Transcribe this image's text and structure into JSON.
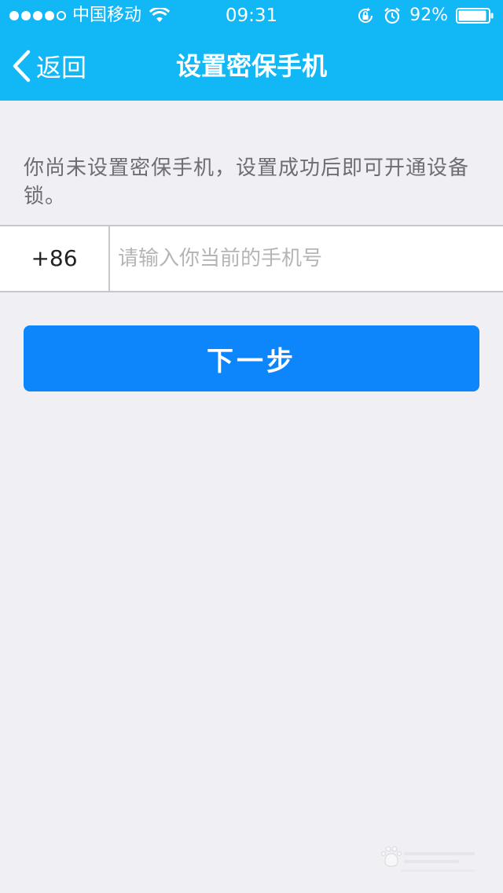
{
  "status_bar": {
    "carrier": "中国移动",
    "time": "09:31",
    "battery": "92%"
  },
  "nav": {
    "back_label": "返回",
    "title": "设置密保手机"
  },
  "description": "你尚未设置密保手机，设置成功后即可开通设备锁。",
  "phone": {
    "country_code": "+86",
    "value": "",
    "placeholder": "请输入你当前的手机号"
  },
  "next_button_label": "下一步",
  "colors": {
    "header": "#12b7f5",
    "primary_button": "#0e86fb",
    "background": "#efeff4"
  }
}
